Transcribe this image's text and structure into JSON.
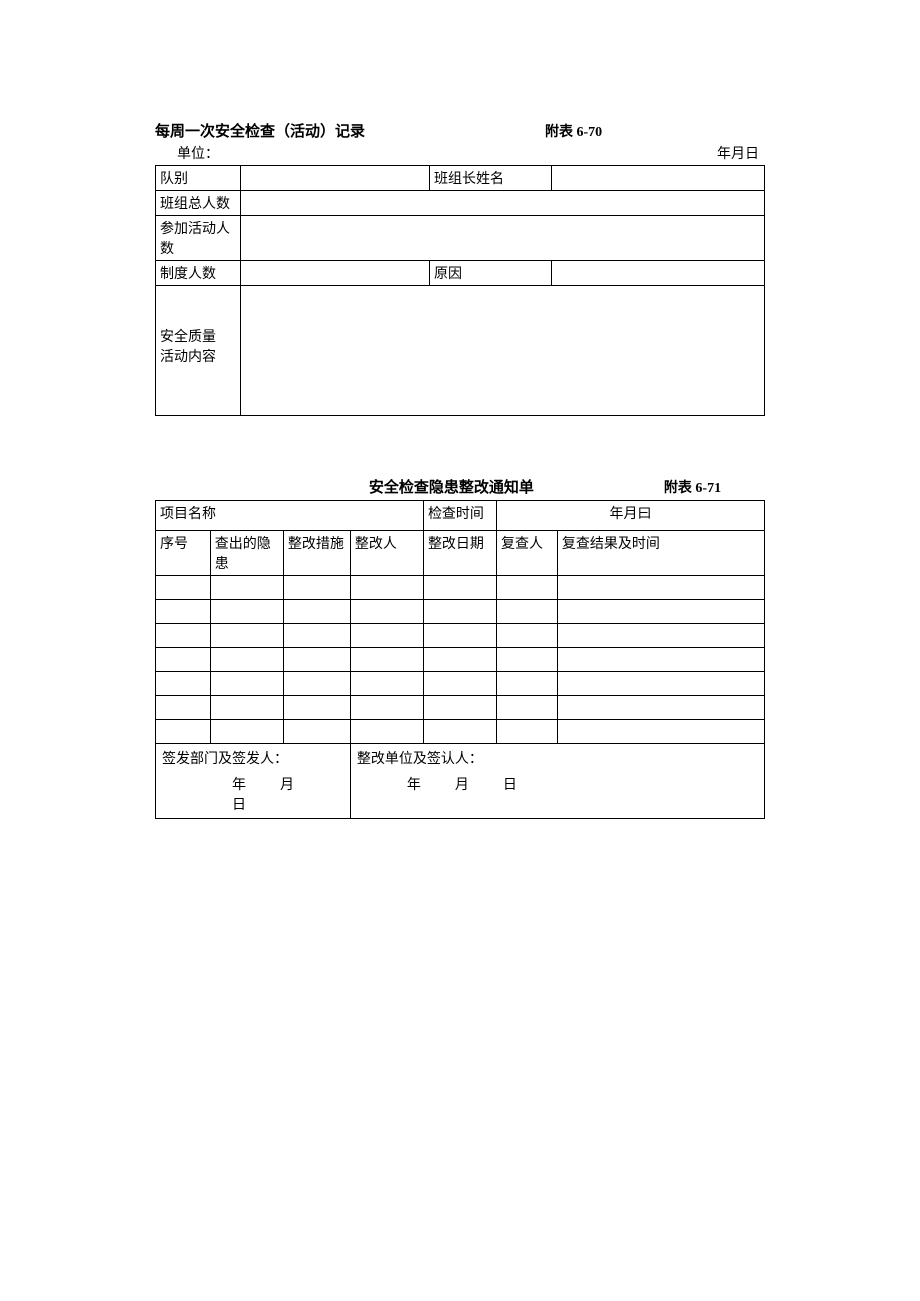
{
  "form1": {
    "title": "每周一次安全检查（活动）记录",
    "appendix": "附表 6-70",
    "unitLabel": "单位：",
    "dateLabel": "年月日",
    "rows": {
      "teamLabel": "队别",
      "teamValue": "",
      "leaderLabel": "班组长姓名",
      "leaderValue": "",
      "totalLabel": "班组总人数",
      "totalValue": "",
      "attendLabel": "参加活动人数",
      "attendValue": "",
      "ruleLabel": "制度人数",
      "ruleValue": "",
      "reasonLabel": "原因",
      "reasonValue": "",
      "contentLabel1": "安全质量",
      "contentLabel2": "活动内容",
      "contentValue": ""
    }
  },
  "form2": {
    "title": "安全检查隐患整改通知单",
    "appendix": "附表 6-71",
    "projectLabel": "项目名称",
    "projectValue": "",
    "checkTimeLabel": "检查时间",
    "checkTimeValue": "年月曰",
    "columns": {
      "c1": "序号",
      "c2": "查出的隐患",
      "c3": "整改措施",
      "c4": "整改人",
      "c5": "整改日期",
      "c6": "复查人",
      "c7": "复查结果及时间"
    },
    "rows": [
      {
        "c1": "",
        "c2": "",
        "c3": "",
        "c4": "",
        "c5": "",
        "c6": "",
        "c7": ""
      },
      {
        "c1": "",
        "c2": "",
        "c3": "",
        "c4": "",
        "c5": "",
        "c6": "",
        "c7": ""
      },
      {
        "c1": "",
        "c2": "",
        "c3": "",
        "c4": "",
        "c5": "",
        "c6": "",
        "c7": ""
      },
      {
        "c1": "",
        "c2": "",
        "c3": "",
        "c4": "",
        "c5": "",
        "c6": "",
        "c7": ""
      },
      {
        "c1": "",
        "c2": "",
        "c3": "",
        "c4": "",
        "c5": "",
        "c6": "",
        "c7": ""
      },
      {
        "c1": "",
        "c2": "",
        "c3": "",
        "c4": "",
        "c5": "",
        "c6": "",
        "c7": ""
      },
      {
        "c1": "",
        "c2": "",
        "c3": "",
        "c4": "",
        "c5": "",
        "c6": "",
        "c7": ""
      }
    ],
    "footer": {
      "issuerLabel": "签发部门及签发人：",
      "issuerDate": "年　　月　　日",
      "approverLabel": "整改单位及签认人：",
      "approverDate": "年　　月　　日"
    }
  }
}
